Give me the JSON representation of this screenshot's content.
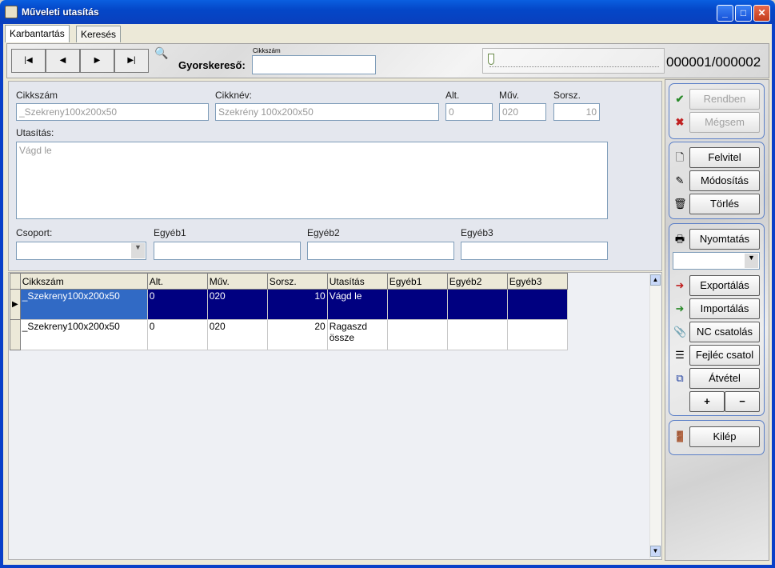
{
  "window": {
    "title": "Műveleti utasítás"
  },
  "tabs": [
    {
      "label": "Karbantartás"
    },
    {
      "label": "Keresés"
    }
  ],
  "toolbar": {
    "quicksearch_small_label": "Cikkszám",
    "quicksearch_label": "Gyorskereső:",
    "quicksearch_value": "",
    "record_counter": "000001/000002"
  },
  "form": {
    "cikkszam_label": "Cikkszám",
    "cikkszam_value": "_Szekreny100x200x50",
    "cikknev_label": "Cikknév:",
    "cikknev_value": "Szekrény 100x200x50",
    "alt_label": "Alt.",
    "alt_value": "0",
    "muv_label": "Műv.",
    "muv_value": "020",
    "sorsz_label": "Sorsz.",
    "sorsz_value": "10",
    "utasitas_label": "Utasítás:",
    "utasitas_value": "Vágd le",
    "csoport_label": "Csoport:",
    "egyeb1_label": "Egyéb1",
    "egyeb2_label": "Egyéb2",
    "egyeb3_label": "Egyéb3"
  },
  "grid": {
    "columns": [
      "Cikkszám",
      "Alt.",
      "Műv.",
      "Sorsz.",
      "Utasítás",
      "Egyéb1",
      "Egyéb2",
      "Egyéb3"
    ],
    "rows": [
      {
        "cikkszam": "_Szekreny100x200x50",
        "alt": "0",
        "muv": "020",
        "sorsz": "10",
        "utasitas": "Vágd le",
        "egyeb1": "",
        "egyeb2": "",
        "egyeb3": ""
      },
      {
        "cikkszam": "_Szekreny100x200x50",
        "alt": "0",
        "muv": "020",
        "sorsz": "20",
        "utasitas": "Ragaszd össze",
        "egyeb1": "",
        "egyeb2": "",
        "egyeb3": ""
      }
    ]
  },
  "side": {
    "ok": "Rendben",
    "cancel": "Mégsem",
    "new": "Felvitel",
    "edit": "Módosítás",
    "delete": "Törlés",
    "print": "Nyomtatás",
    "export": "Exportálás",
    "import": "Importálás",
    "nc": "NC csatolás",
    "header": "Fejléc csatol",
    "transfer": "Átvétel",
    "plus": "+",
    "minus": "−",
    "exit": "Kilép"
  },
  "colors": {
    "titlebar": "#0a5fe0",
    "selection": "#000080",
    "group_border": "#5b7fc7"
  }
}
